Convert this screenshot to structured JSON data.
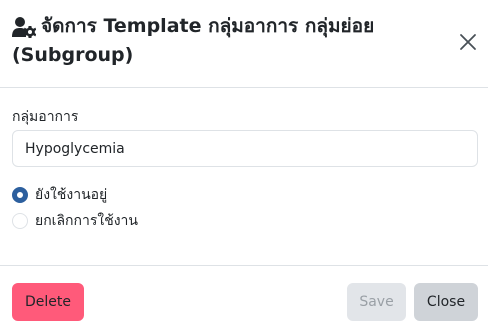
{
  "modal": {
    "title": "จัดการ Template กลุ่มอาการ กลุ่มย่อย (Subgroup)",
    "title_icon": "users-cog-icon",
    "close_icon": "close-icon"
  },
  "form": {
    "group_label": "กลุ่มอาการ",
    "group_value": "Hypoglycemia",
    "status_options": [
      {
        "label": "ยังใช้งานอยู่",
        "checked": true
      },
      {
        "label": "ยกเลิกการใช้งาน",
        "checked": false
      }
    ]
  },
  "footer": {
    "delete_label": "Delete",
    "save_label": "Save",
    "close_label": "Close"
  },
  "colors": {
    "accent_radio": "#2c5f9e",
    "delete_button": "#ff5a7a",
    "save_button_disabled": "#e2e5e9",
    "close_button": "#cfd3d8",
    "divider": "#dee2e6"
  }
}
